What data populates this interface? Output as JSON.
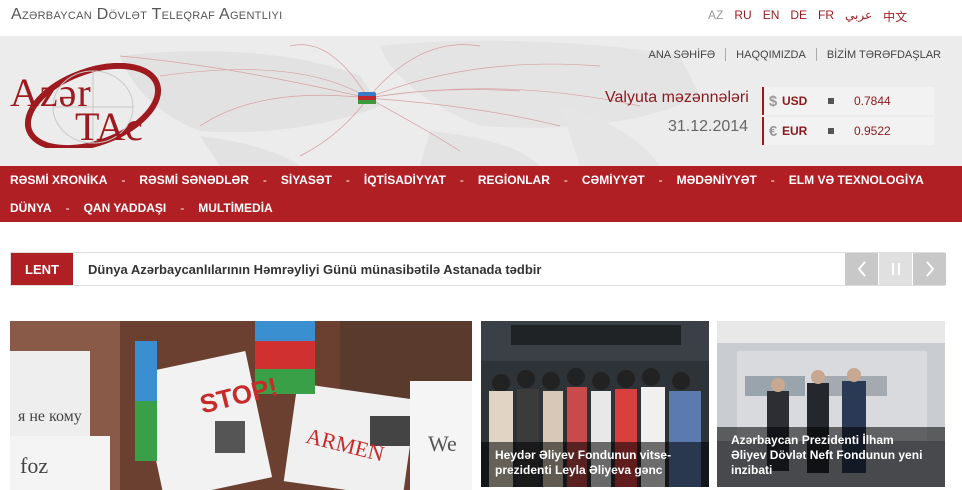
{
  "agency_name": "Azərbaycan Dövlət Teleqraf Agentliyi",
  "languages": [
    {
      "label": "AZ",
      "active": true
    },
    {
      "label": "RU",
      "active": false
    },
    {
      "label": "EN",
      "active": false
    },
    {
      "label": "DE",
      "active": false
    },
    {
      "label": "FR",
      "active": false
    },
    {
      "label": "عربي",
      "active": false
    },
    {
      "label": "中文",
      "active": false
    }
  ],
  "top_links": [
    "ANA SƏHİFƏ",
    "HAQQIMIZDA",
    "BİZİM TƏRƏFDAŞLAR"
  ],
  "logo": {
    "line1": "Azər",
    "line2": "TAc"
  },
  "valuta": {
    "title": "Valyuta məzənnələri",
    "date": "31.12.2014",
    "rates": [
      {
        "symbol": "$",
        "code": "USD",
        "value": "0.7844"
      },
      {
        "symbol": "€",
        "code": "EUR",
        "value": "0.9522"
      }
    ]
  },
  "nav": {
    "row1": [
      "RƏSMİ XRONİKA",
      "RƏSMİ SƏNƏDLƏR",
      "SİYASƏT",
      "İQTİSADİYYAT",
      "REGİONLAR",
      "CƏMİYYƏT",
      "MƏDƏNİYYƏT",
      "ELM VƏ TEXNOLOGİYA"
    ],
    "row2": [
      "DÜNYA",
      "QAN YADDAŞI",
      "MULTİMEDİA"
    ]
  },
  "lent": {
    "label": "LENT",
    "headline": "Dünya Azərbaycanlılarının Həmrəyliyi Günü münasibətilə Astanada tədbir"
  },
  "news": {
    "mid_caption": "Heydər Əliyev Fondunun vitse-prezidenti Leyla Əliyeva gənc",
    "right_caption": "Azərbaycan Prezidenti İlham Əliyev Dövlət Neft Fondunun yeni inzibati"
  },
  "colors": {
    "brand_red": "#b01f24",
    "dark_red": "#8a1a1e"
  }
}
